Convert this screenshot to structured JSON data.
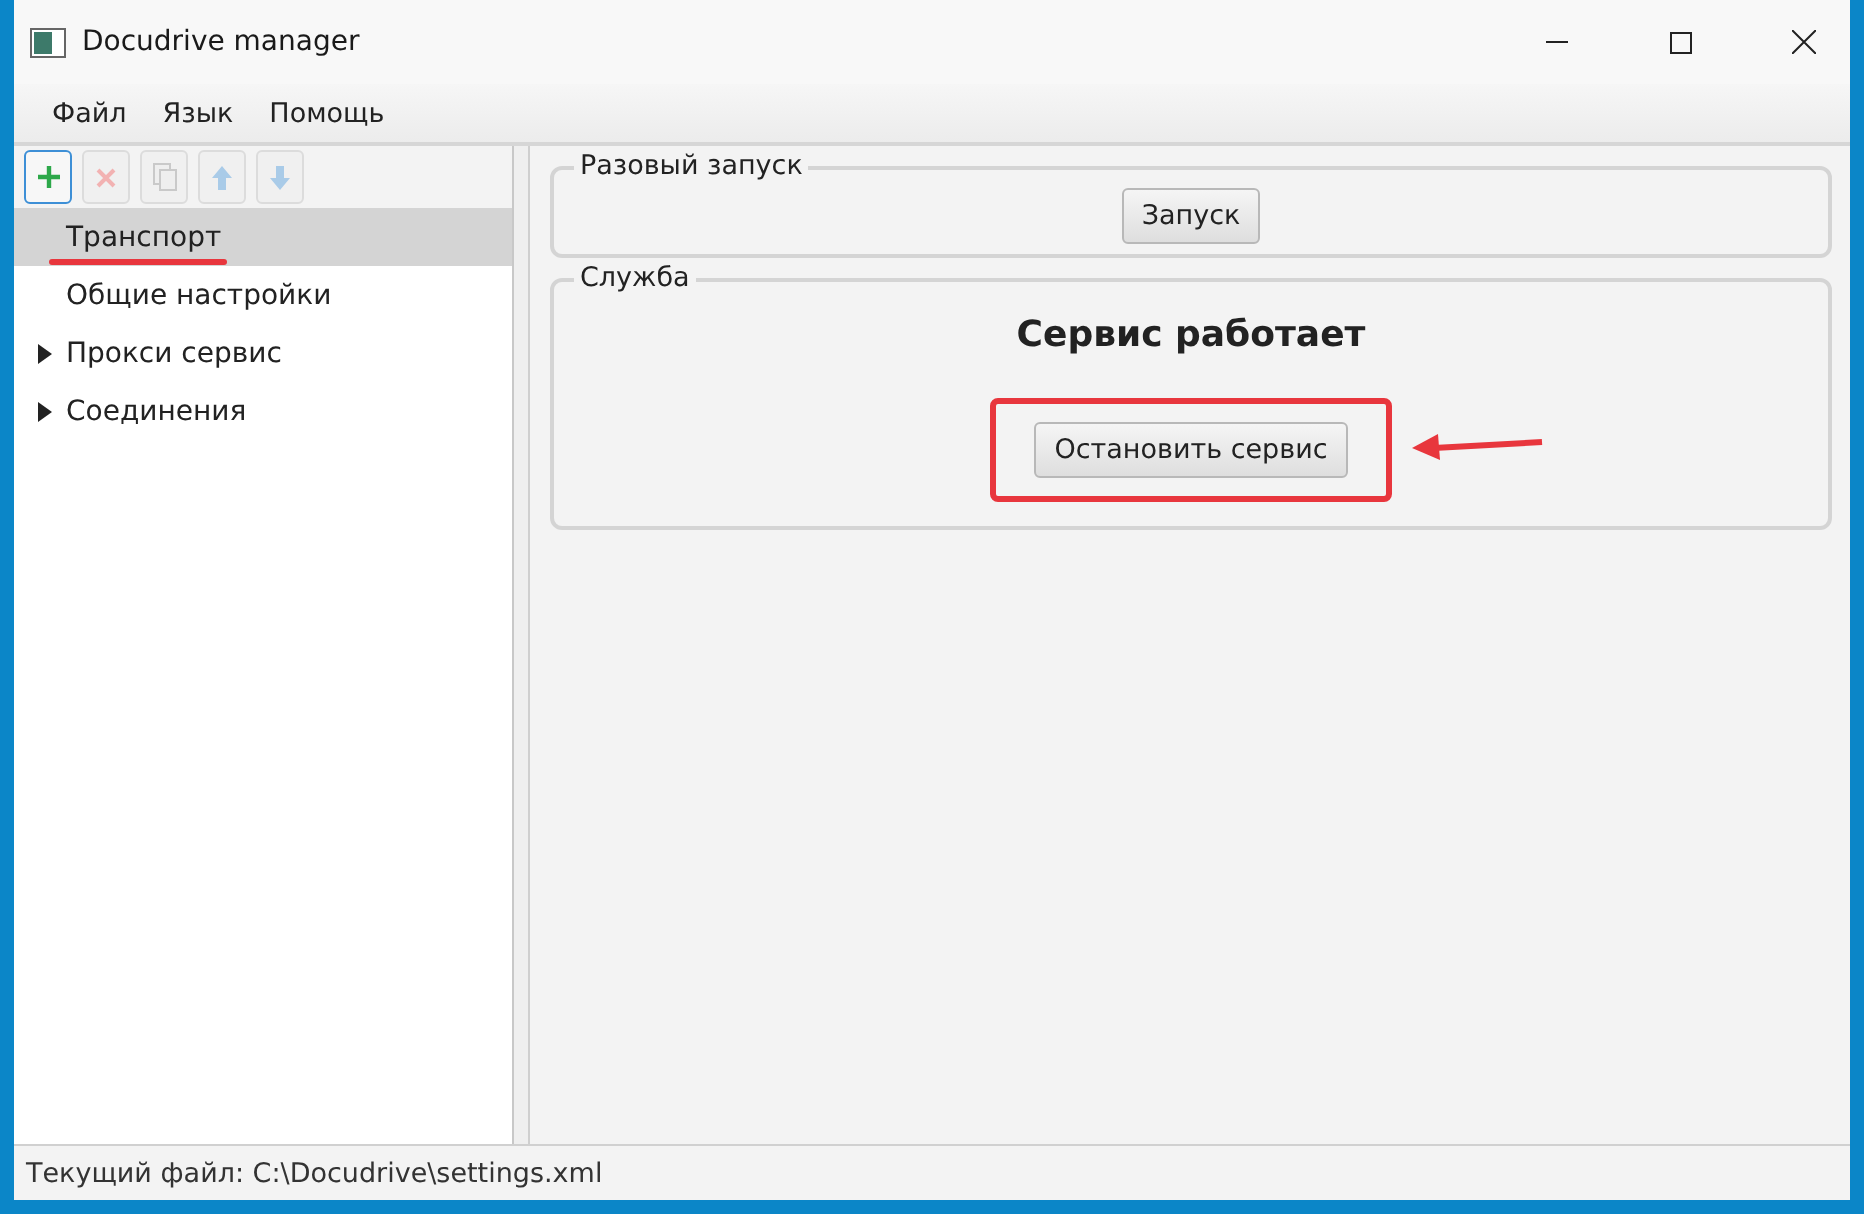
{
  "window": {
    "title": "Docudrive manager"
  },
  "menu": [
    "Файл",
    "Язык",
    "Помощь"
  ],
  "toolbar": [
    {
      "kind": "add",
      "disabled": false
    },
    {
      "kind": "delete",
      "disabled": true
    },
    {
      "kind": "copy",
      "disabled": true
    },
    {
      "kind": "up",
      "disabled": true
    },
    {
      "kind": "down",
      "disabled": true
    }
  ],
  "tree": [
    {
      "label": "Транспорт",
      "selected": true,
      "kind": "leaf"
    },
    {
      "label": "Общие настройки",
      "selected": false,
      "kind": "leaf"
    },
    {
      "label": "Прокси сервис",
      "selected": false,
      "kind": "branch"
    },
    {
      "label": "Соединения",
      "selected": false,
      "kind": "branch"
    }
  ],
  "groups": [
    {
      "title": "Разовый запуск",
      "button": "Запуск",
      "highlighted": false
    },
    {
      "title": "Служба",
      "status": "Сервис работает",
      "button": "Остановить сервис",
      "highlighted": true
    }
  ],
  "status_bar": "Текущий файл: C:\\Docudrive\\settings.xml"
}
